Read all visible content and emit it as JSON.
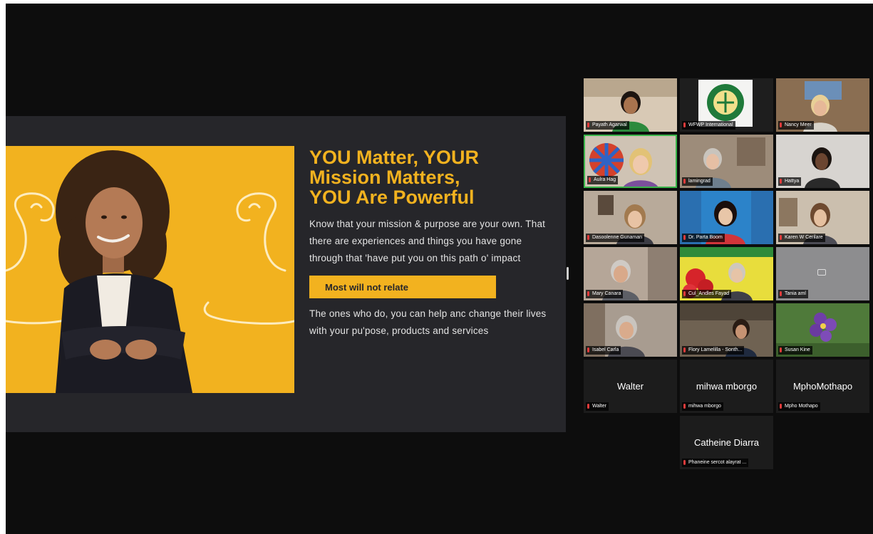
{
  "slide": {
    "headline_lines": [
      "YOU Matter, YOUR",
      "Mission Matters,",
      "YOU Are Powerful"
    ],
    "paragraph1": "Know that your mission & purpose are your own. That there are experiences and things you have gone through that 'have put you on this path o' impact",
    "cta_label": "Most will not relate",
    "paragraph2": "The ones who do, you can help anc change their lives with your pu'pose, products and services"
  },
  "gallery": {
    "tiles": [
      {
        "name": "Payath Agarwal"
      },
      {
        "name": "WFWP International"
      },
      {
        "name": "Nancy Meer"
      },
      {
        "name": "Aulra Hag",
        "active": true
      },
      {
        "name": "lamingrad"
      },
      {
        "name": "Hattya"
      },
      {
        "name": "Dasoolenne Gunaman"
      },
      {
        "name": "Dr. Parta Boom"
      },
      {
        "name": "Karen W Cerilare"
      },
      {
        "name": "Mary Canara"
      },
      {
        "name": "Cul_Andles Fayad"
      },
      {
        "name": "Tania aml"
      },
      {
        "name": "Isabel Carla"
      },
      {
        "name": "Flory Lamelilla - Sonth..."
      },
      {
        "name": "Susan Kine"
      },
      {
        "name": "Walter",
        "display_name": "Walter"
      },
      {
        "name": "mihwa mborgo",
        "display_name": "mihwa mborgo"
      },
      {
        "name": "Mpho Mothapo",
        "display_name": "MphoMothapo"
      },
      {
        "name": "Phaneine sercot alayrat ...",
        "display_name": "Catheine Diarra"
      }
    ]
  },
  "colors": {
    "brand_yellow": "#f2b21f",
    "slide_bg": "#26262a",
    "stage_bg": "#0d0d0d",
    "active_speaker": "#3ab54a"
  }
}
